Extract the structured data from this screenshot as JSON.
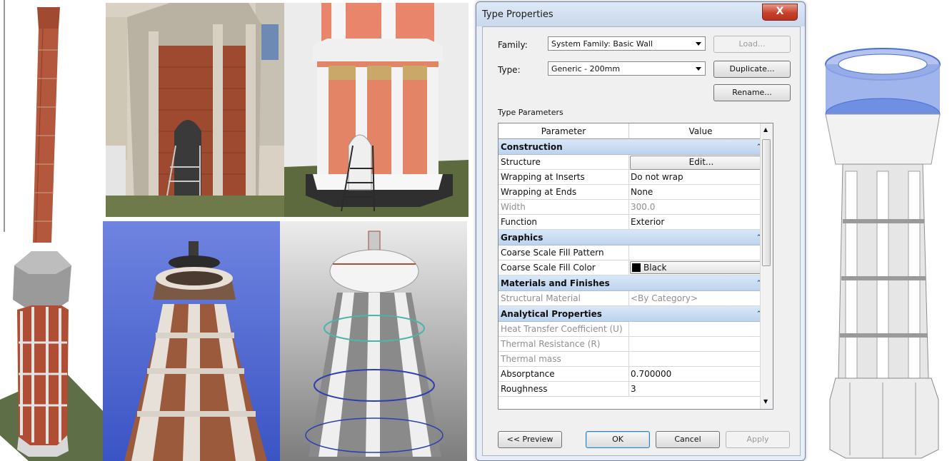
{
  "dialog": {
    "title": "Type Properties",
    "close_label": "X",
    "family_label": "Family:",
    "family_value": "System Family: Basic Wall",
    "type_label": "Type:",
    "type_value": "Generic - 200mm",
    "load_label": "Load...",
    "duplicate_label": "Duplicate...",
    "rename_label": "Rename...",
    "section_label": "Type Parameters",
    "col_parameter": "Parameter",
    "col_value": "Value",
    "categories": {
      "construction": "Construction",
      "graphics": "Graphics",
      "materials": "Materials and Finishes",
      "analytical": "Analytical Properties"
    },
    "rows": {
      "structure": {
        "param": "Structure",
        "value": "Edit..."
      },
      "wrap_inserts": {
        "param": "Wrapping at Inserts",
        "value": "Do not wrap"
      },
      "wrap_ends": {
        "param": "Wrapping at Ends",
        "value": "None"
      },
      "width": {
        "param": "Width",
        "value": "300.0"
      },
      "function": {
        "param": "Function",
        "value": "Exterior"
      },
      "fill_pattern": {
        "param": "Coarse Scale Fill Pattern",
        "value": ""
      },
      "fill_color": {
        "param": "Coarse Scale Fill Color",
        "value": "Black"
      },
      "struct_material": {
        "param": "Structural Material",
        "value": "<By Category>"
      },
      "heat": {
        "param": "Heat Transfer Coefficient (U)",
        "value": ""
      },
      "thermal_res": {
        "param": "Thermal Resistance (R)",
        "value": ""
      },
      "thermal_mass": {
        "param": "Thermal mass",
        "value": ""
      },
      "absorptance": {
        "param": "Absorptance",
        "value": "0.700000"
      },
      "roughness": {
        "param": "Roughness",
        "value": "3"
      }
    },
    "preview_label": "<< Preview",
    "ok_label": "OK",
    "cancel_label": "Cancel",
    "apply_label": "Apply"
  },
  "colors": {
    "brick": "#b3583c",
    "salmon": "#e48466",
    "category_band": "#bcd3ee",
    "ghost_blue": "#8fa8e8",
    "sky": "#4f6fd6"
  }
}
